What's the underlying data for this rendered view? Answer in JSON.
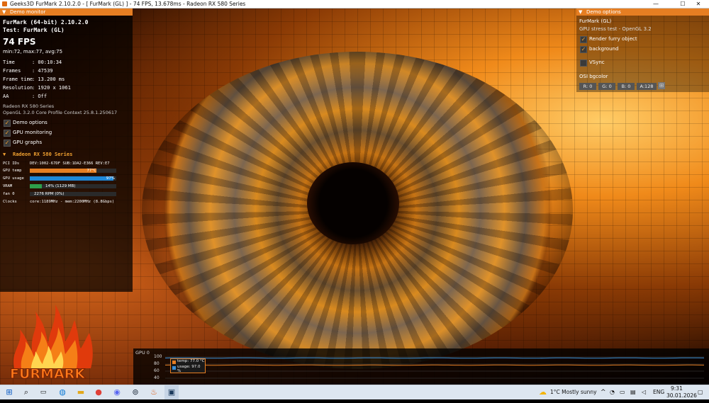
{
  "window": {
    "title": "Geeks3D FurMark 2.10.2.0 - [ FurMark (GL) ] - 74 FPS, 13.678ms - Radeon RX 580 Series",
    "minimize": "—",
    "maximize": "☐",
    "close": "✕"
  },
  "demo_monitor": {
    "header": "Demo monitor",
    "app_line": "FurMark (64-bit) 2.10.2.0",
    "test_line": "Test: FurMark (GL)",
    "fps": "74 FPS",
    "fps_stats": "min:72, max:77, avg:75",
    "stats": [
      {
        "label": "Time",
        "value": ": 00:10:34"
      },
      {
        "label": "Frames",
        "value": ": 47539"
      },
      {
        "label": "Frame time",
        "value": ": 13.200 ms"
      },
      {
        "label": "Resolution",
        "value": ": 1920 x 1061"
      },
      {
        "label": "AA",
        "value": ": Off"
      }
    ],
    "gpu_name": "Radeon RX 580 Series",
    "opengl": "OpenGL 3.2.0 Core Profile Context 25.8.1.250617",
    "options": [
      {
        "label": "Demo options",
        "checked": true
      },
      {
        "label": "GPU monitoring",
        "checked": true
      },
      {
        "label": "GPU graphs",
        "checked": true
      }
    ]
  },
  "gpu_monitor": {
    "header": "Radeon RX 580 Series",
    "pci_label": "PCI IDs",
    "pci_value": "DEV:1002-67DF SUB:1DA2-E366 REV:E7",
    "temp_label": "GPU temp",
    "temp_value": "77°C",
    "temp_fraction": 0.77,
    "usage_label": "GPU usage",
    "usage_value": "97%",
    "usage_fraction": 0.97,
    "vram_label": "VRAM",
    "vram_value": "14% (1129 MB)",
    "vram_fraction": 0.14,
    "fan_label": "fan 0",
    "fan_value": "2276 RPM (0%)",
    "fan_fraction": 0.0,
    "clocks_label": "Clocks",
    "clocks_value": "core:1189MHz - mem:2200MHz (8.8Gbps)"
  },
  "demo_options": {
    "header": "Demo options",
    "title": "FurMark (GL)",
    "subtitle": "GPU stress test - OpenGL 3.2",
    "render_furry": "Render furry object",
    "background": "background",
    "vsync": "VSync",
    "osi_bgcolor": "OSI bgcolor",
    "chips": [
      "R: 0",
      "G: 0",
      "B: 0",
      "A:128"
    ]
  },
  "graph": {
    "title": "GPU 0",
    "y_ticks": [
      "100",
      "80",
      "60",
      "40"
    ],
    "legend_temp": "temp: 77.0 °C",
    "legend_usage": "usage: 97.0 %",
    "temp_color": "#e67e22",
    "usage_color": "#3a8fd6"
  },
  "logo": {
    "text": "FURMARK"
  },
  "taskbar": {
    "weather": "1°C  Mostly sunny",
    "lang": "ENG",
    "time": "9:31",
    "date": "30.01.2026"
  },
  "colors": {
    "accent": "#e67e22",
    "usage_bar": "#1e88d8",
    "vram_bar": "#2e9e4a"
  }
}
